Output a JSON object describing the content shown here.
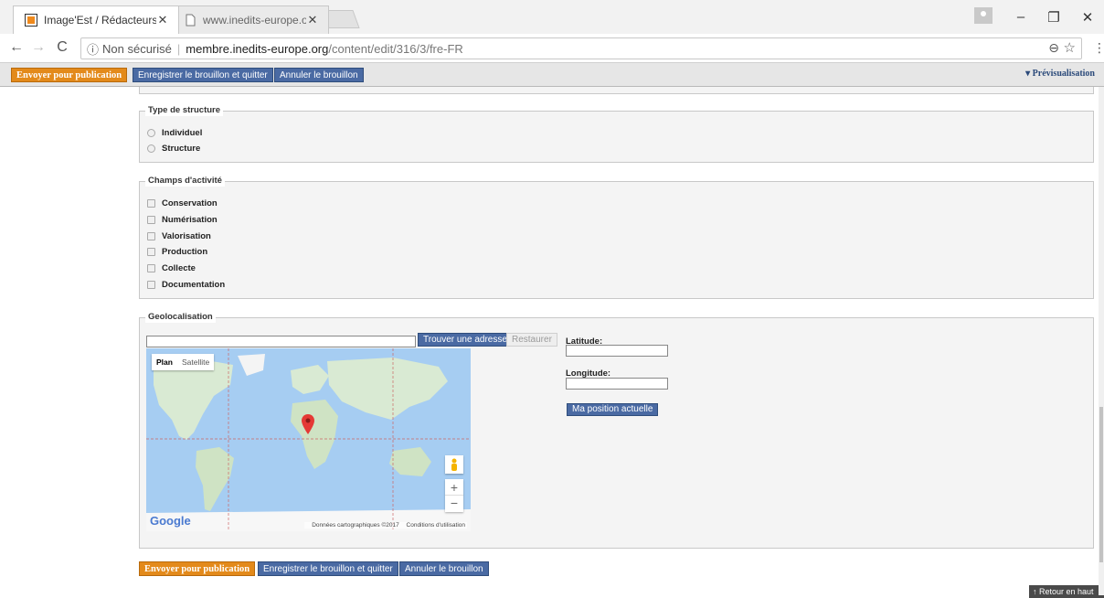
{
  "browser": {
    "tabs": [
      {
        "title": "Image'Est / Rédacteurs /",
        "active": true
      },
      {
        "title": "www.inedits-europe.org/",
        "active": false
      }
    ],
    "address": {
      "info_icon": "ⓘ",
      "security": "Non sécurisé",
      "host": "membre.inedits-europe.org",
      "path": "/content/edit/316/3/fre-FR"
    }
  },
  "toolbar": {
    "publish": "Envoyer pour publication",
    "save_quit": "Enregistrer le brouillon et quitter",
    "cancel": "Annuler le brouillon",
    "preview": "▾ Prévisualisation"
  },
  "structure": {
    "legend": "Type de structure",
    "options": [
      "Individuel",
      "Structure"
    ]
  },
  "activity": {
    "legend": "Champs d'activité",
    "options": [
      "Conservation",
      "Numérisation",
      "Valorisation",
      "Production",
      "Collecte",
      "Documentation"
    ]
  },
  "geo": {
    "legend": "Geolocalisation",
    "find_button": "Trouver une adresse",
    "restore_button": "Restaurer",
    "latitude_label": "Latitude:",
    "longitude_label": "Longitude:",
    "position_button": "Ma position actuelle",
    "map": {
      "type_plan": "Plan",
      "type_satellite": "Satellite",
      "logo": "Google",
      "attribution": "Données cartographiques ©2017",
      "terms": "Conditions d'utilisation",
      "zoom_in": "+",
      "zoom_out": "−"
    }
  },
  "footer": {
    "publish": "Envoyer pour publication",
    "save_quit": "Enregistrer le brouillon et quitter",
    "cancel": "Annuler le brouillon",
    "back_to_top": "↑ Retour en haut"
  }
}
